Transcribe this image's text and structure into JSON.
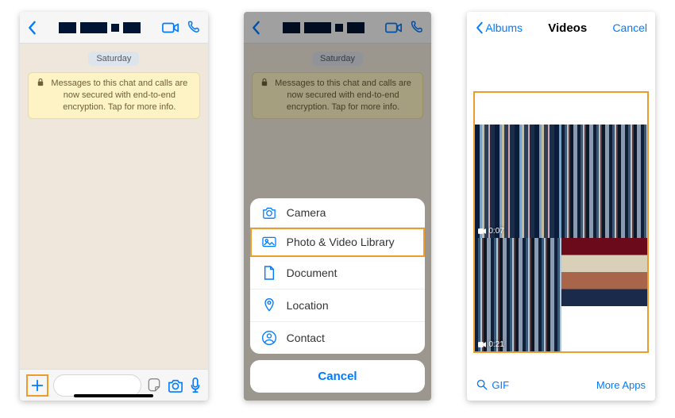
{
  "screen1": {
    "day": "Saturday",
    "encryption_notice": "Messages to this chat and calls are now secured with end-to-end encryption. Tap for more info."
  },
  "screen2": {
    "day": "Saturday",
    "encryption_notice": "Messages to this chat and calls are now secured with end-to-end encryption. Tap for more info.",
    "sheet": {
      "items": [
        {
          "icon": "camera-icon",
          "label": "Camera"
        },
        {
          "icon": "photo-library-icon",
          "label": "Photo & Video Library"
        },
        {
          "icon": "document-icon",
          "label": "Document"
        },
        {
          "icon": "location-icon",
          "label": "Location"
        },
        {
          "icon": "contact-icon",
          "label": "Contact"
        }
      ],
      "selected_index": 1,
      "cancel": "Cancel"
    }
  },
  "screen3": {
    "back": "Albums",
    "title": "Videos",
    "cancel": "Cancel",
    "thumbs": [
      {
        "duration": "0:07"
      },
      {
        "duration": ""
      },
      {
        "duration": "0:21"
      }
    ],
    "footer": {
      "gif": "GIF",
      "more": "More Apps"
    }
  },
  "colors": {
    "accent": "#007aff",
    "highlight": "#ef9a2c"
  }
}
